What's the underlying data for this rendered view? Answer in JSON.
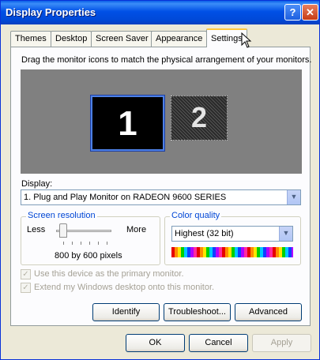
{
  "window": {
    "title": "Display Properties",
    "help_label": "?",
    "close_label": "✕"
  },
  "tabs": [
    {
      "label": "Themes"
    },
    {
      "label": "Desktop"
    },
    {
      "label": "Screen Saver"
    },
    {
      "label": "Appearance"
    },
    {
      "label": "Settings",
      "active": true
    }
  ],
  "settings": {
    "instruction": "Drag the monitor icons to match the physical arrangement of your monitors.",
    "monitors": [
      {
        "label": "1",
        "selected": true
      },
      {
        "label": "2",
        "selected": false
      }
    ],
    "display_label": "Display:",
    "display_value": "1. Plug and Play Monitor on RADEON 9600 SERIES",
    "resolution": {
      "group_title": "Screen resolution",
      "less_label": "Less",
      "more_label": "More",
      "value_text": "800 by 600 pixels",
      "slider_fraction": 0.0
    },
    "color_quality": {
      "group_title": "Color quality",
      "value": "Highest (32 bit)"
    },
    "checkboxes": [
      {
        "label": "Use this device as the primary monitor.",
        "checked": true,
        "enabled": false
      },
      {
        "label": "Extend my Windows desktop onto this monitor.",
        "checked": true,
        "enabled": false
      }
    ],
    "buttons": {
      "identify": "Identify",
      "troubleshoot": "Troubleshoot...",
      "advanced": "Advanced"
    }
  },
  "footer": {
    "ok": "OK",
    "cancel": "Cancel",
    "apply": "Apply"
  },
  "icons": {
    "dropdown": "chevron-down-icon",
    "cursor": "mouse-pointer-icon"
  }
}
